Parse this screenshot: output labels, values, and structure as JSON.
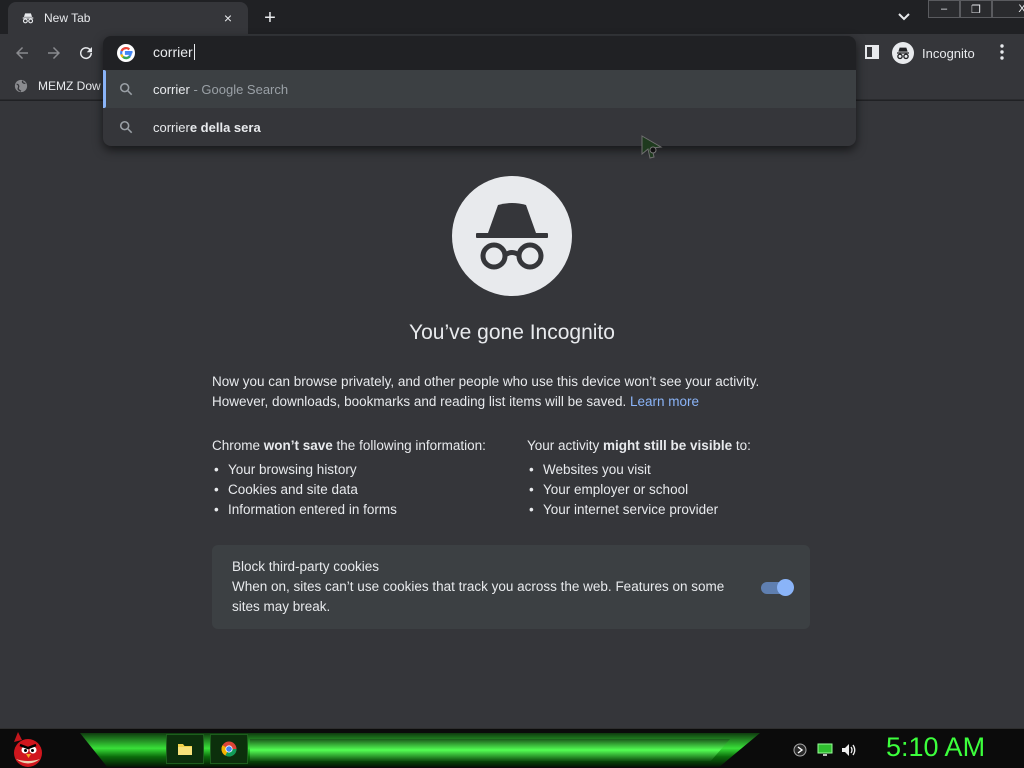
{
  "browser": {
    "tab": {
      "title": "New Tab",
      "close_glyph": "×",
      "icon": "incognito-icon"
    },
    "new_tab_glyph": "+",
    "window_controls": {
      "minimize": "–",
      "restore": "❐",
      "close": "X"
    },
    "profile": {
      "label": "Incognito",
      "icon": "incognito-icon"
    },
    "bookmarks": [
      {
        "label": "MEMZ Dow",
        "icon": "globe-icon"
      }
    ]
  },
  "omnibox": {
    "query": "corrier",
    "suggestions": [
      {
        "match": "corrier",
        "rest": "",
        "sub": " - Google Search",
        "selected": true
      },
      {
        "match": "corrier",
        "rest": "e della sera",
        "sub": "",
        "selected": false
      }
    ]
  },
  "page": {
    "headline": "You’ve gone Incognito",
    "intro_line1": "Now you can browse privately, and other people who use this device won’t see your activity.",
    "intro_line2": "However, downloads, bookmarks and reading list items will be saved.",
    "learn_more": "Learn more",
    "left_column": {
      "prefix": "Chrome ",
      "emphasis": "won’t save",
      "suffix": " the following information:",
      "items": [
        "Your browsing history",
        "Cookies and site data",
        "Information entered in forms"
      ]
    },
    "right_column": {
      "prefix": "Your activity ",
      "emphasis": "might still be visible",
      "suffix": " to:",
      "items": [
        "Websites you visit",
        "Your employer or school",
        "Your internet service provider"
      ]
    },
    "cookie_card": {
      "title": "Block third-party cookies",
      "description": "When on, sites can’t use cookies that track you across the web. Features on some sites may break.",
      "toggle_on": true
    }
  },
  "taskbar": {
    "clock": "5:10 AM",
    "apps": [
      "file-explorer-icon",
      "chrome-icon"
    ],
    "tray": [
      "network-icon",
      "monitor-icon",
      "volume-icon"
    ]
  },
  "colors": {
    "accent": "#8ab4f8",
    "page_bg": "#35363a",
    "clock": "#3cff3c"
  }
}
